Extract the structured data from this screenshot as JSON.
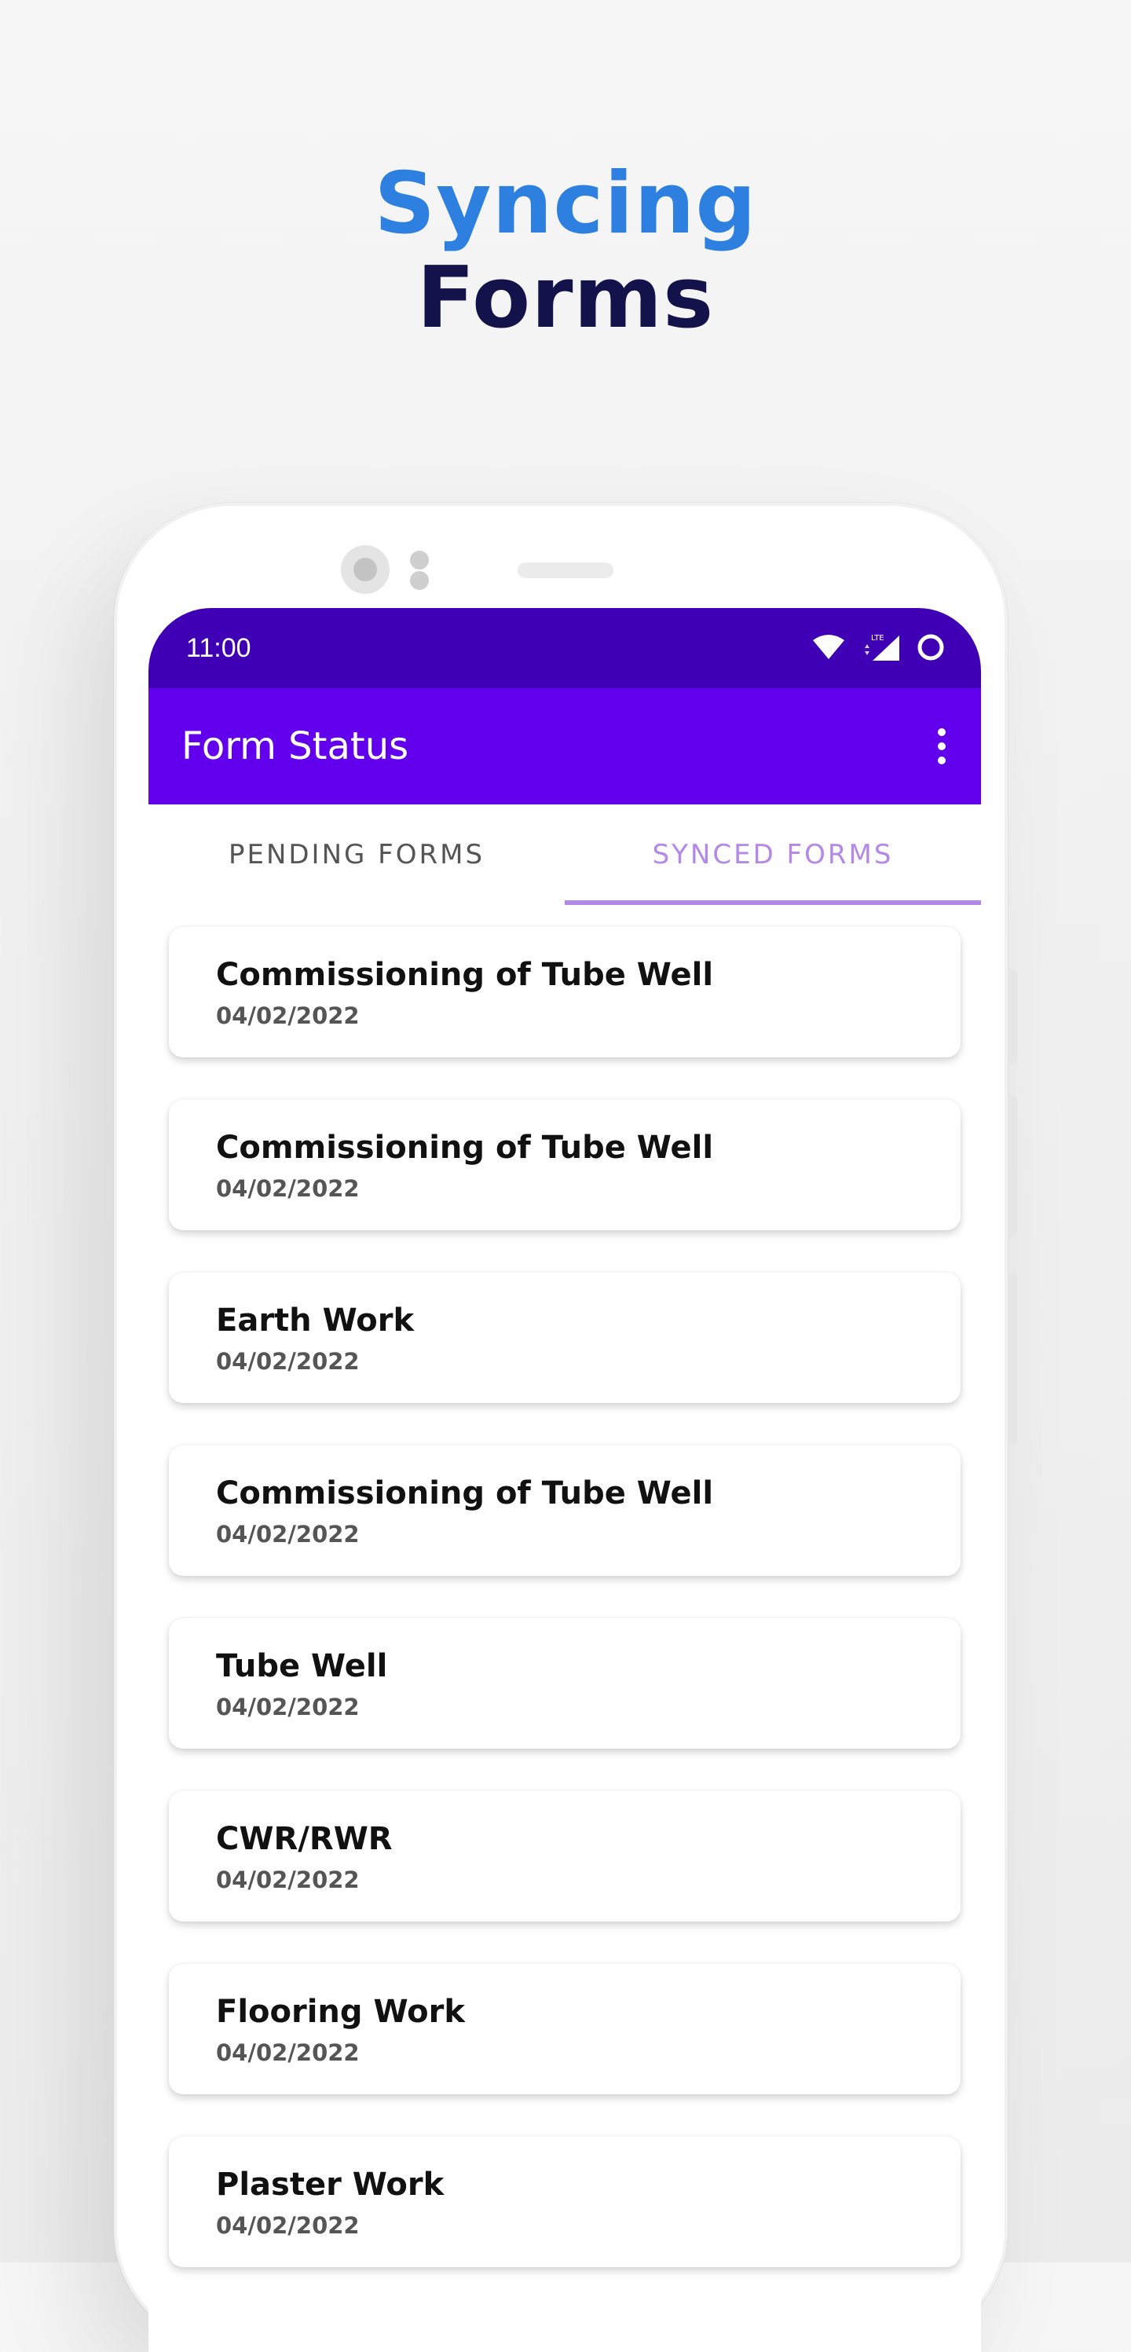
{
  "headline": {
    "line1": "Syncing",
    "line2": "Forms"
  },
  "colors": {
    "headline_accent": "#2d7fe0",
    "headline_dark": "#14124a",
    "status_bar": "#3f00b5",
    "app_bar": "#6200ee",
    "tab_active": "#b388e8"
  },
  "status_bar": {
    "time": "11:00",
    "icons": [
      "wifi-icon",
      "lte-signal-icon",
      "battery-ring-icon"
    ]
  },
  "app_bar": {
    "title": "Form Status",
    "menu_icon": "more-vert-icon"
  },
  "tabs": [
    {
      "label": "PENDING FORMS",
      "active": false
    },
    {
      "label": "SYNCED FORMS",
      "active": true
    }
  ],
  "forms": [
    {
      "name": "Commissioning of Tube Well",
      "date": "04/02/2022"
    },
    {
      "name": "Commissioning of Tube Well",
      "date": "04/02/2022"
    },
    {
      "name": "Earth Work",
      "date": "04/02/2022"
    },
    {
      "name": "Commissioning of Tube Well",
      "date": "04/02/2022"
    },
    {
      "name": "Tube Well",
      "date": "04/02/2022"
    },
    {
      "name": "CWR/RWR",
      "date": "04/02/2022"
    },
    {
      "name": "Flooring Work",
      "date": "04/02/2022"
    },
    {
      "name": "Plaster Work",
      "date": "04/02/2022"
    }
  ]
}
